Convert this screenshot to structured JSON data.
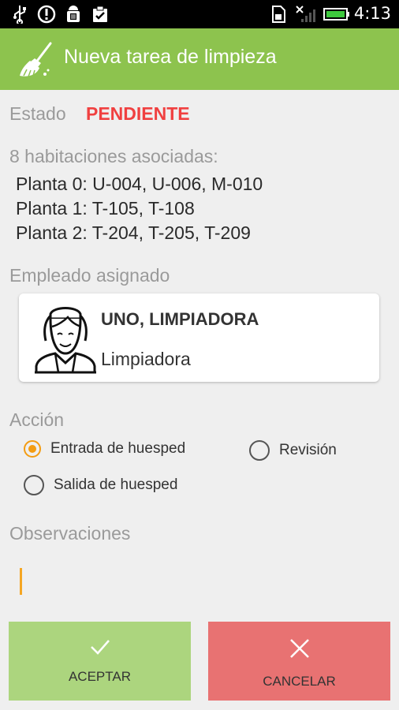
{
  "status_bar": {
    "time": "4:13",
    "icons": [
      "usb-icon",
      "alert-icon",
      "android-debug-icon",
      "clipboard-check-icon",
      "sd-card-icon",
      "no-signal-icon",
      "battery-icon"
    ]
  },
  "app_bar": {
    "title": "Nueva tarea de limpieza",
    "icon": "broom-icon",
    "color": "#8dc34e"
  },
  "estado": {
    "label": "Estado",
    "value": "PENDIENTE",
    "value_color": "#f04040"
  },
  "habitaciones": {
    "title": "8 habitaciones asociadas:",
    "plantas": [
      "Planta 0: U-004, U-006, M-010",
      "Planta 1: T-105, T-108",
      "Planta 2: T-204, T-205, T-209"
    ]
  },
  "empleado": {
    "label": "Empleado asignado",
    "name": "UNO, LIMPIADORA",
    "role": "Limpiadora",
    "avatar_icon": "cleaning-lady-icon"
  },
  "accion": {
    "label": "Acción",
    "options": [
      {
        "label": "Entrada de huesped",
        "checked": true
      },
      {
        "label": "Revisión",
        "checked": false
      },
      {
        "label": "Salida de huesped",
        "checked": false
      }
    ]
  },
  "observaciones": {
    "label": "Observaciones",
    "value": ""
  },
  "buttons": {
    "accept": {
      "label": "ACEPTAR",
      "icon": "check-icon",
      "color": "#acd57e"
    },
    "cancel": {
      "label": "CANCELAR",
      "icon": "close-icon",
      "color": "#e87272"
    }
  }
}
